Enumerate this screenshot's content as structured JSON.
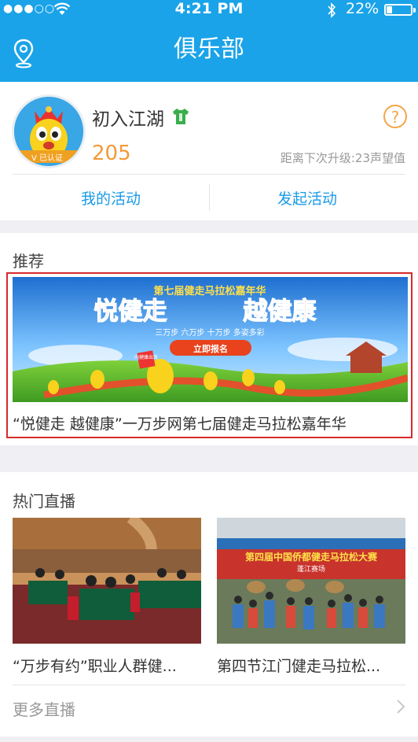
{
  "status": {
    "time": "4:21 PM",
    "battery_pct": "22%",
    "battery_level": 0.22
  },
  "nav": {
    "title": "俱乐部"
  },
  "profile": {
    "username": "初入江湖",
    "score": "205",
    "next_level": "距离下次升级:23声望值",
    "help": "?",
    "avatar_badge": "V 已认证"
  },
  "tabs": {
    "my_activities": "我的活动",
    "start_activity": "发起活动"
  },
  "recommend": {
    "section_title": "推荐",
    "banner": {
      "top": "第七届健走马拉松嘉年华",
      "headline_a": "悦健走",
      "headline_b": "越健康",
      "steps": "三万步 六万步 十万步 多姿多彩",
      "cta": "立即报名",
      "sign": "向健康出发"
    },
    "caption": "“悦健走 越健康”一万步网第七届健走马拉松嘉年华"
  },
  "live": {
    "section_title": "热门直播",
    "items": [
      {
        "caption": "“万步有约”职业人群健..."
      },
      {
        "caption": "第四节江门健走马拉松...",
        "banner_text": "第四届中国侨都健走马拉松大赛",
        "sub": "蓬江赛场"
      }
    ],
    "more": "更多直播"
  },
  "colors": {
    "brand": "#1aa3e8",
    "accent_orange": "#f29a3a",
    "highlight_red": "#d82a2a"
  }
}
